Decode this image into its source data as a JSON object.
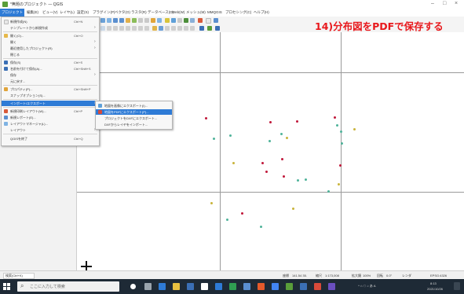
{
  "window": {
    "title": "*無題のプロジェクト — QGIS",
    "controls": [
      "–",
      "□",
      "×"
    ]
  },
  "annotation": "14)分布図をPDFで保存する",
  "menubar": {
    "items": [
      "プロジェクト",
      "編集(E)",
      "ビュー(V)",
      "レイヤ(L)",
      "設定(S)",
      "プラグイン(P)",
      "ベクタ(O)",
      "ラスタ(R)",
      "データベース(D)",
      "Web(W)",
      "メッシュ(M)",
      "MMQGIS",
      "プロセシング(C)",
      "ヘルプ(H)"
    ],
    "active_index": 0
  },
  "project_menu": {
    "items": [
      {
        "label": "新規作成(N)",
        "shortcut": "Ctrl+N",
        "arrow": false
      },
      {
        "label": "テンプレートから新規作成",
        "shortcut": "",
        "arrow": true
      },
      {
        "label": "開く(O)...",
        "shortcut": "Ctrl+O",
        "arrow": false
      },
      {
        "label": "開く",
        "shortcut": "",
        "arrow": true
      },
      {
        "label": "最近使用したプロジェクト(R)",
        "shortcut": "",
        "arrow": true
      },
      {
        "label": "閉じる",
        "shortcut": "",
        "arrow": false
      },
      {
        "label": "保存(S)",
        "shortcut": "Ctrl+S",
        "arrow": false
      },
      {
        "label": "名前を付けて保存(A)...",
        "shortcut": "Ctrl+Shift+S",
        "arrow": false
      },
      {
        "label": "保存",
        "shortcut": "",
        "arrow": true
      },
      {
        "label": "元に戻す...",
        "shortcut": "",
        "arrow": false
      },
      {
        "label": "プロパティ(P)...",
        "shortcut": "Ctrl+Shift+P",
        "arrow": false
      },
      {
        "label": "スナップオプション(S)...",
        "shortcut": "",
        "arrow": false
      },
      {
        "label": "インポート/エクスポート",
        "shortcut": "",
        "arrow": true
      },
      {
        "label": "新規印刷レイアウト(W)...",
        "shortcut": "Ctrl+P",
        "arrow": false
      },
      {
        "label": "新規レポート(E)...",
        "shortcut": "",
        "arrow": false
      },
      {
        "label": "レイアウトマネージャ(L)...",
        "shortcut": "",
        "arrow": false
      },
      {
        "label": "レイアウト",
        "shortcut": "",
        "arrow": true
      },
      {
        "label": "QGISを終了",
        "shortcut": "Ctrl+Q",
        "arrow": false
      }
    ],
    "highlighted_index": 12
  },
  "export_submenu": {
    "items": [
      "地図を画像にエクスポート(I)...",
      "地図をPDFにエクスポート(P)...",
      "プロジェクトをDXFにエクスポート...",
      "DXFからレイヤをインポート..."
    ],
    "highlighted_index": 1
  },
  "statusbar": {
    "search_placeholder": "検索(Ctrl+K)",
    "coordinate_label": "座標",
    "coordinate_value": "141.54 35.",
    "scale_label": "縮尺",
    "scale_value": "1:173,008",
    "magnifier_label": "拡大鏡",
    "magnifier_value": "100%",
    "rotation_label": "回転",
    "rotation_value": "0.0°",
    "render_label": "レンダ",
    "crs_value": "EPSG:4326"
  },
  "taskbar": {
    "search_text": "ここに入力して検索",
    "clock_time": "8:13",
    "clock_date": "2021/10/26",
    "tray_text": "^ ⌂ ☁ ♪ あ A"
  },
  "colors": {
    "accent": "#2e7bd6",
    "annotation": "#e8181c",
    "point_red": "#c0183a",
    "point_teal": "#4fb39a",
    "point_yellow": "#c9b33a"
  }
}
